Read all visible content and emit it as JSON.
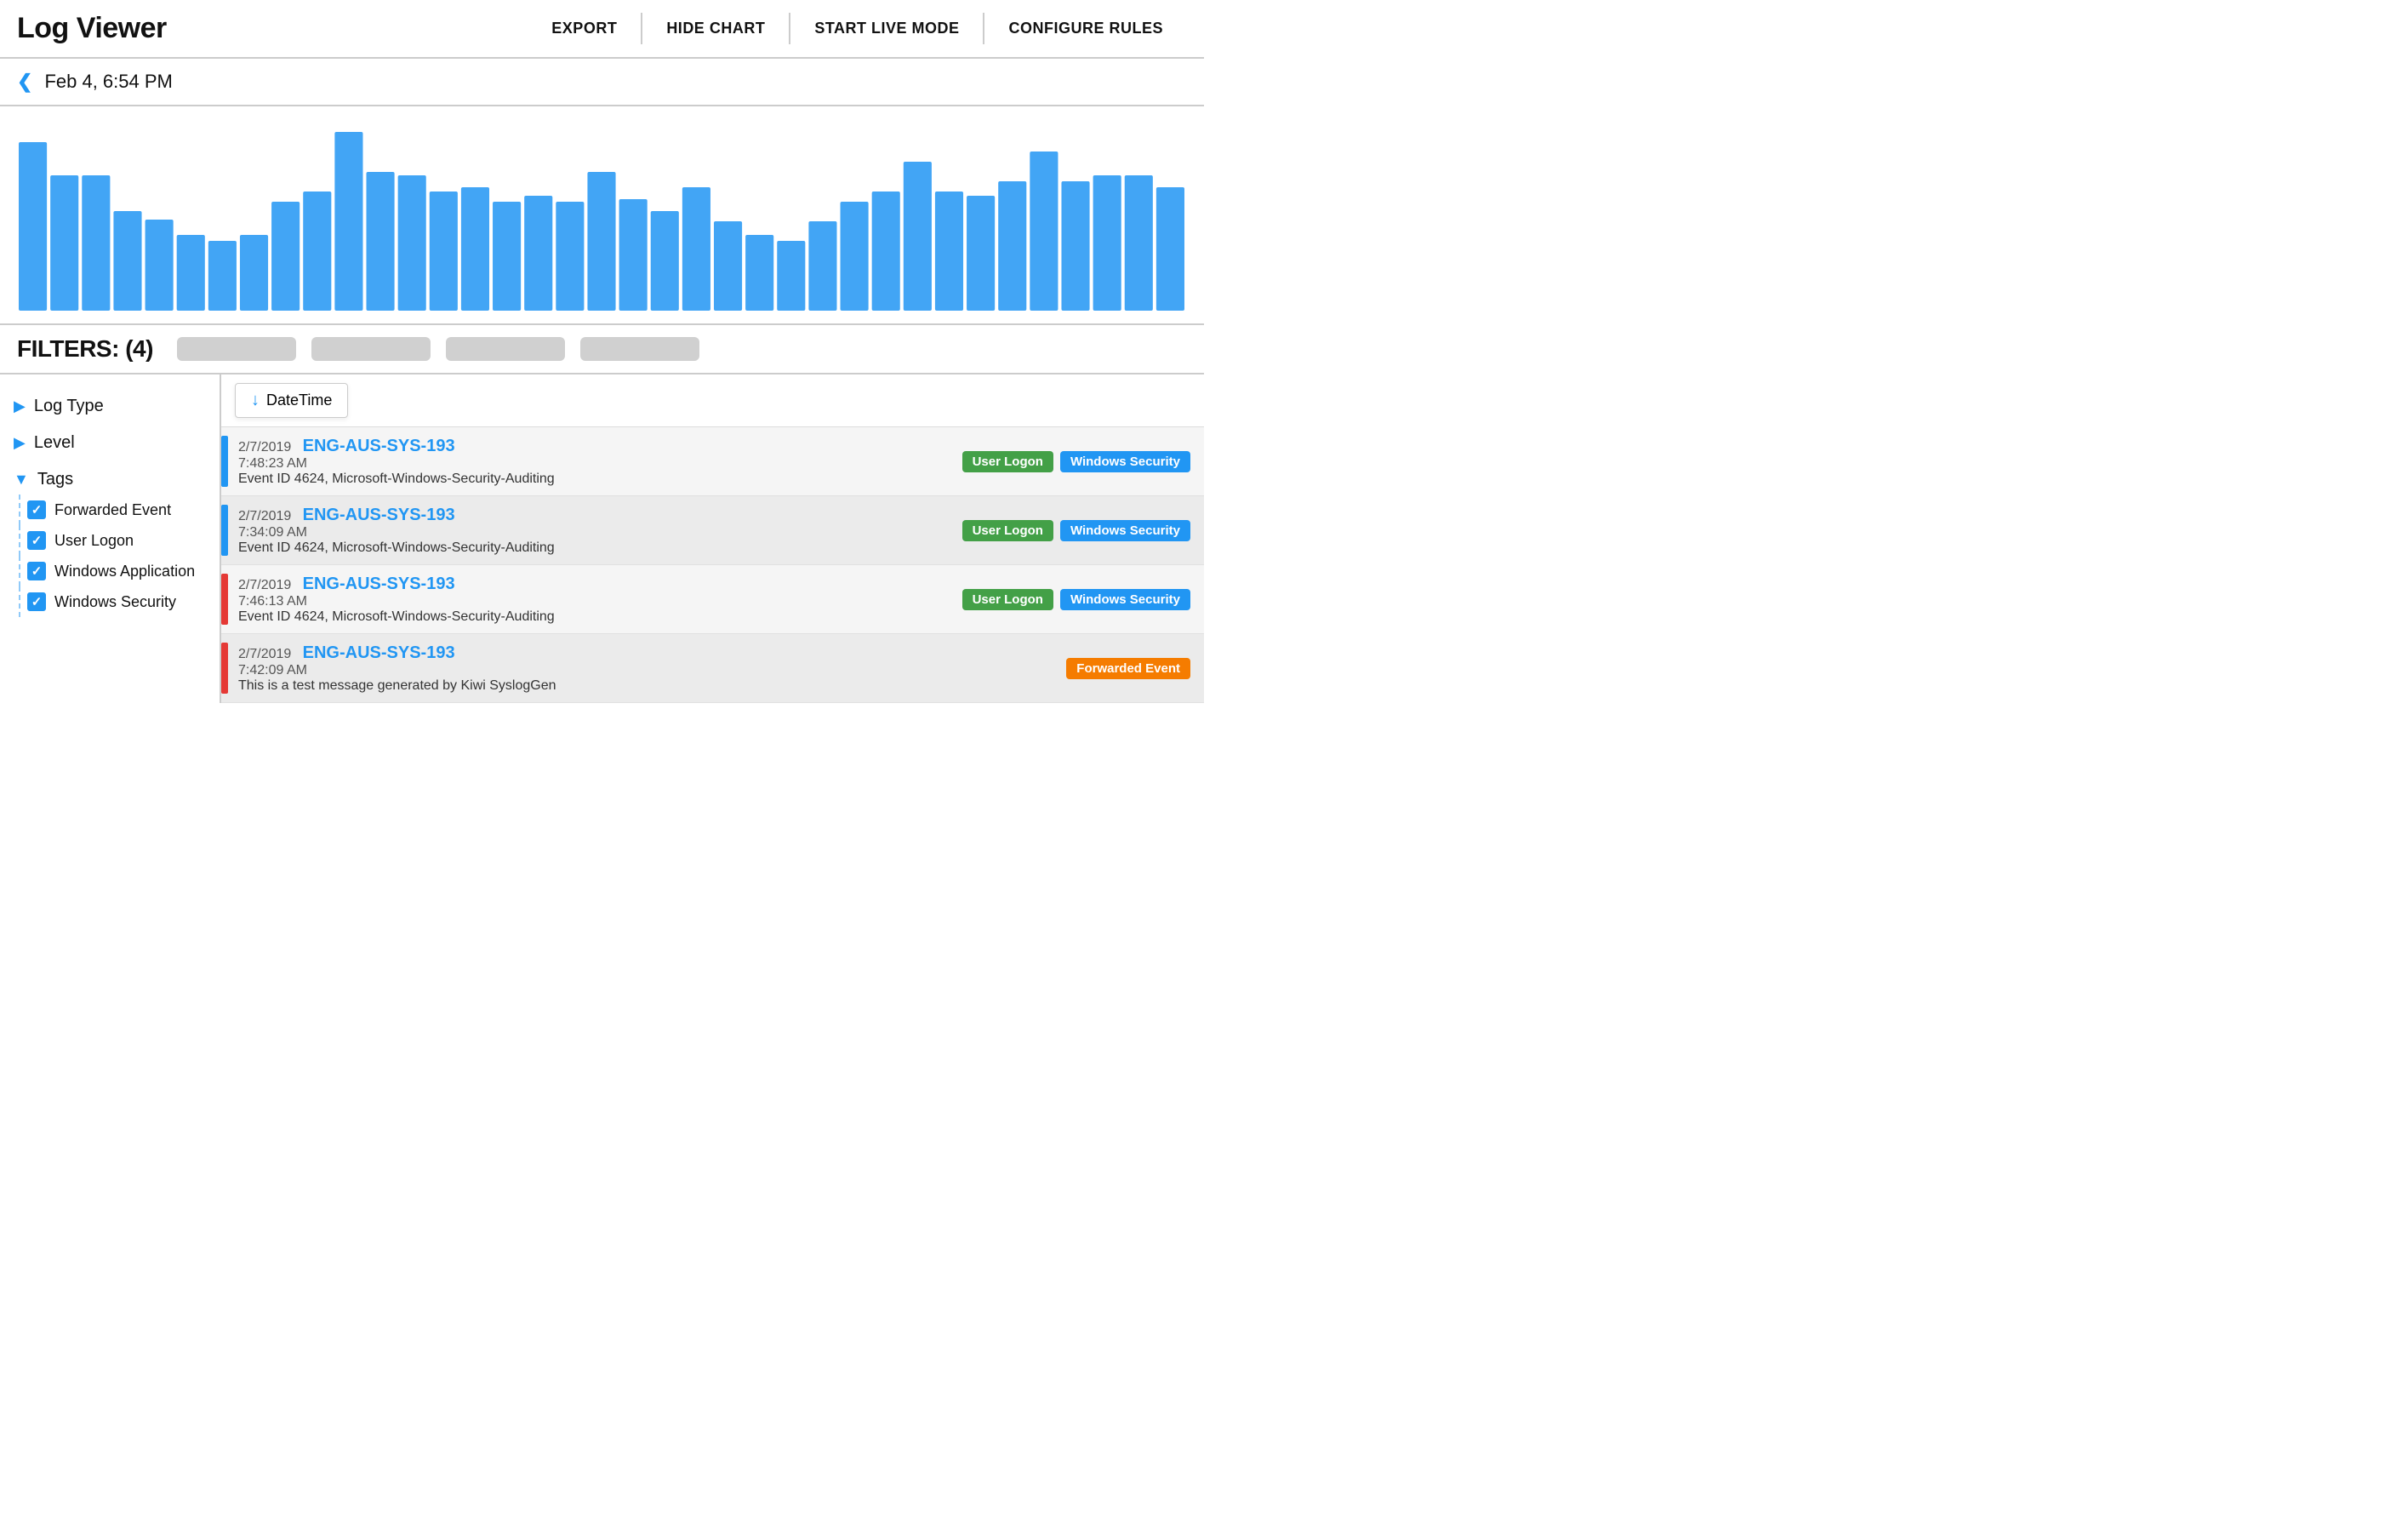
{
  "header": {
    "title": "Log Viewer",
    "actions": [
      {
        "id": "export",
        "label": "EXPORT"
      },
      {
        "id": "hide-chart",
        "label": "HIDE CHART"
      },
      {
        "id": "start-live-mode",
        "label": "START LIVE MODE"
      },
      {
        "id": "configure-rules",
        "label": "CONFIGURE RULES"
      }
    ]
  },
  "date_nav": {
    "label": "Feb 4, 6:54 PM",
    "prev_label": "‹"
  },
  "chart": {
    "bars": [
      85,
      68,
      68,
      50,
      46,
      38,
      35,
      38,
      55,
      60,
      90,
      70,
      68,
      60,
      62,
      55,
      58,
      55,
      70,
      56,
      50,
      62,
      45,
      38,
      35,
      45,
      55,
      60,
      75,
      60,
      58,
      65,
      80,
      65,
      68,
      68,
      62
    ]
  },
  "filters": {
    "title": "FILTERS: (4)",
    "pills": [
      "",
      "",
      "",
      ""
    ]
  },
  "sidebar": {
    "items": [
      {
        "id": "log-type",
        "label": "Log Type",
        "expanded": false
      },
      {
        "id": "level",
        "label": "Level",
        "expanded": false
      }
    ],
    "tags": {
      "label": "Tags",
      "expanded": true,
      "items": [
        {
          "id": "forwarded-event",
          "label": "Forwarded Event",
          "checked": true
        },
        {
          "id": "user-logon",
          "label": "User Logon",
          "checked": true
        },
        {
          "id": "windows-application",
          "label": "Windows Application",
          "checked": true
        },
        {
          "id": "windows-security",
          "label": "Windows Security",
          "checked": true
        }
      ]
    }
  },
  "log_table": {
    "sort_label": "DateTime",
    "sort_icon": "↓",
    "rows": [
      {
        "id": "row-1",
        "indicator": "blue",
        "date": "2/7/2019",
        "time": "7:48:23 AM",
        "host": "ENG-AUS-SYS-193",
        "desc": "Event ID 4624, Microsoft-Windows-Security-Auditing",
        "tags": [
          {
            "label": "User Logon",
            "color": "green"
          },
          {
            "label": "Windows Security",
            "color": "blue"
          }
        ]
      },
      {
        "id": "row-2",
        "indicator": "blue",
        "date": "2/7/2019",
        "time": "7:34:09 AM",
        "host": "ENG-AUS-SYS-193",
        "desc": "Event ID 4624, Microsoft-Windows-Security-Auditing",
        "tags": [
          {
            "label": "User Logon",
            "color": "green"
          },
          {
            "label": "Windows Security",
            "color": "blue"
          }
        ]
      },
      {
        "id": "row-3",
        "indicator": "red",
        "date": "2/7/2019",
        "time": "7:46:13 AM",
        "host": "ENG-AUS-SYS-193",
        "desc": "Event ID 4624, Microsoft-Windows-Security-Auditing",
        "tags": [
          {
            "label": "User Logon",
            "color": "green"
          },
          {
            "label": "Windows Security",
            "color": "blue"
          }
        ]
      },
      {
        "id": "row-4",
        "indicator": "red",
        "date": "2/7/2019",
        "time": "7:42:09 AM",
        "host": "ENG-AUS-SYS-193",
        "desc": "This is a test message generated by Kiwi SyslogGen",
        "tags": [
          {
            "label": "Forwarded Event",
            "color": "orange"
          }
        ]
      }
    ]
  }
}
